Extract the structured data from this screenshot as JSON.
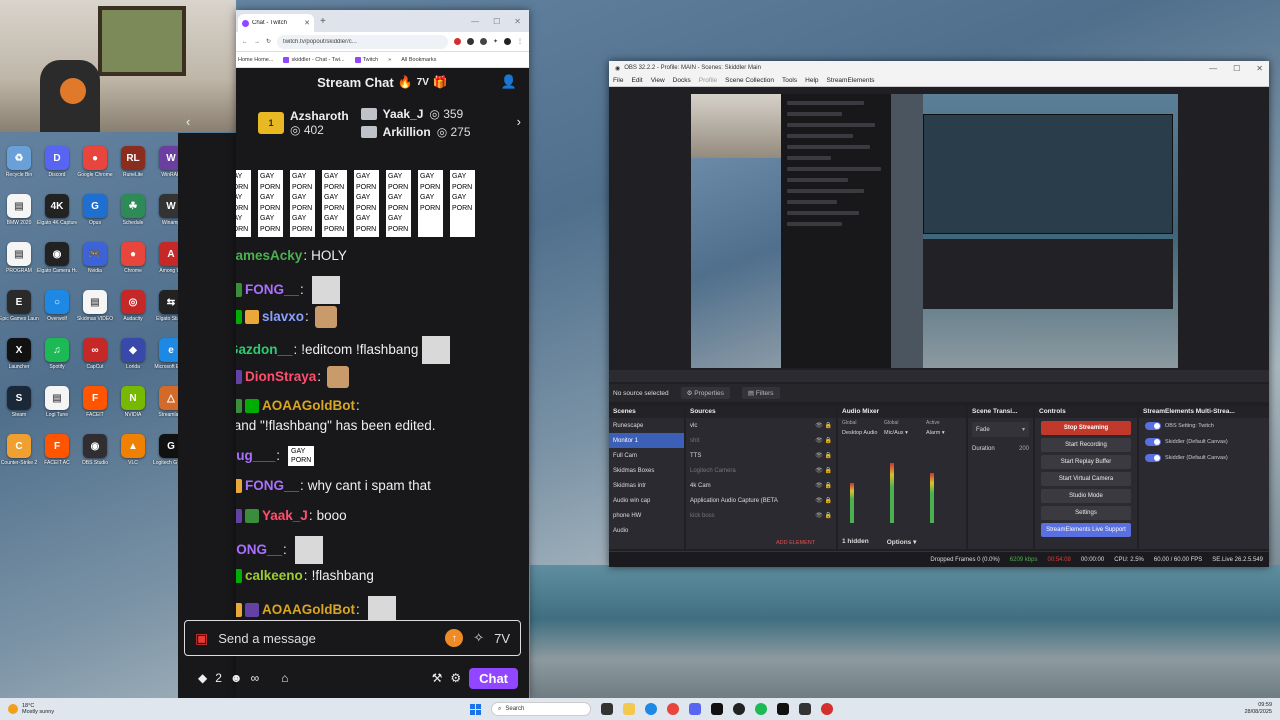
{
  "desktop": {
    "icons": [
      {
        "label": "Recycle Bin",
        "color": "#6aa0d8",
        "glyph": "♻"
      },
      {
        "label": "Discord",
        "color": "#5865f2",
        "glyph": "D"
      },
      {
        "label": "Google Chrome",
        "color": "#e8453c",
        "glyph": "●"
      },
      {
        "label": "RuneLite",
        "color": "#8a2d1e",
        "glyph": "RL"
      },
      {
        "label": "WinRAR",
        "color": "#6b3fa0",
        "glyph": "W"
      },
      {
        "label": "BMW 2020",
        "color": "#f5f5f5",
        "glyph": "▤"
      },
      {
        "label": "Elgato 4K Capture",
        "color": "#222",
        "glyph": "4K"
      },
      {
        "label": "Opus",
        "color": "#1f6fd1",
        "glyph": "G"
      },
      {
        "label": "Schedule",
        "color": "#2e8b57",
        "glyph": "☘"
      },
      {
        "label": "Winamp",
        "color": "#333",
        "glyph": "W"
      },
      {
        "label": "PROGRAM",
        "color": "#f5f5f5",
        "glyph": "▤"
      },
      {
        "label": "Elgato Camera Hub",
        "color": "#222",
        "glyph": "◉"
      },
      {
        "label": "Nvidia",
        "color": "#3c64d8",
        "glyph": "🎮"
      },
      {
        "label": "Chrome",
        "color": "#e8453c",
        "glyph": "●"
      },
      {
        "label": "Among Us",
        "color": "#c62828",
        "glyph": "A"
      },
      {
        "label": "Epic Games Launcher",
        "color": "#2a2a2a",
        "glyph": "E"
      },
      {
        "label": "Overwolf",
        "color": "#1e88e5",
        "glyph": "○"
      },
      {
        "label": "Skidmas VIDEO",
        "color": "#f5f5f5",
        "glyph": "▤"
      },
      {
        "label": "Audacity",
        "color": "#c62828",
        "glyph": "◎"
      },
      {
        "label": "Elgato Studio",
        "color": "#222",
        "glyph": "⇆"
      },
      {
        "label": "Launcher",
        "color": "#111",
        "glyph": "X"
      },
      {
        "label": "Spotify",
        "color": "#1db954",
        "glyph": "♫"
      },
      {
        "label": "CapCut",
        "color": "#c62828",
        "glyph": "∞"
      },
      {
        "label": "Lorida",
        "color": "#3949ab",
        "glyph": "◆"
      },
      {
        "label": "Microsoft Edge",
        "color": "#1e88e5",
        "glyph": "e"
      },
      {
        "label": "Steam",
        "color": "#1b2838",
        "glyph": "S"
      },
      {
        "label": "Logi Tune",
        "color": "#f5f5f5",
        "glyph": "▤"
      },
      {
        "label": "FACEIT",
        "color": "#ff5500",
        "glyph": "F"
      },
      {
        "label": "NVIDIA",
        "color": "#76b900",
        "glyph": "N"
      },
      {
        "label": "Streamlabs",
        "color": "#d36a2a",
        "glyph": "△"
      },
      {
        "label": "Counter-Strike 2",
        "color": "#f0a030",
        "glyph": "C"
      },
      {
        "label": "FACEIT AC",
        "color": "#ff5500",
        "glyph": "F"
      },
      {
        "label": "OBS Studio",
        "color": "#302e31",
        "glyph": "◉"
      },
      {
        "label": "VLC",
        "color": "#f08000",
        "glyph": "▲"
      },
      {
        "label": "Logitech G HUB",
        "color": "#111",
        "glyph": "G"
      }
    ]
  },
  "browser": {
    "tab_title": "Chat - Twitch",
    "url": "twitch.tv/popout/skiddler/c...",
    "bookmarks": [
      "Home Home...",
      "skiddler - Chat - Twi...",
      "Twitch"
    ],
    "all_bookmarks": "All Bookmarks"
  },
  "chat": {
    "header_title": "Stream Chat",
    "leaderboard": {
      "first": {
        "name": "Azsharoth",
        "count": "402",
        "rank": "1"
      },
      "others": [
        {
          "name": "Yaak_J",
          "count": "359"
        },
        {
          "name": "Arkillion",
          "count": "275"
        }
      ]
    },
    "spam_blocks": [
      "GAY PORN GAY PORN GAY PORN",
      "GAY PORN GAY PORN GAY PORN",
      "GAY PORN GAY PORN GAY PORN",
      "GAY PORN GAY PORN GAY PORN",
      "GAY PORN GAY PORN GAY PORN",
      "GAY PORN GAY PORN GAY PORN",
      "GAY PORN GAY PORN GAY PORN",
      "GAY PORN GAY PORN",
      "GAY PORN GAY PORN"
    ],
    "messages": [
      {
        "user": "JamesAcky",
        "color": "#4caf50",
        "text": "HOLY"
      },
      {
        "user": "FONG__",
        "color": "#a970ff",
        "text": ""
      },
      {
        "user": "slavxo",
        "color": "#8aa0ff",
        "text": ""
      },
      {
        "user": "Gazdon__",
        "color": "#2ecc71",
        "text": "!editcom !flashbang"
      },
      {
        "user": "DionStraya",
        "color": "#ff4f6d",
        "text": ""
      },
      {
        "user": "AOAAGoldBot",
        "color": "#daa520",
        "text": "Command \"!flashbang\" has been edited."
      },
      {
        "user": "Fug___",
        "color": "#a970ff",
        "text": ""
      },
      {
        "user": "FONG__",
        "color": "#a970ff",
        "text": "why cant i spam that"
      },
      {
        "user": "Yaak_J",
        "color": "#ff4f6d",
        "text": "booo"
      },
      {
        "user": "FONG__",
        "color": "#a970ff",
        "text": ""
      },
      {
        "user": "calkeeno",
        "color": "#9acd32",
        "text": "!flashbang"
      },
      {
        "user": "AOAAGoldBot",
        "color": "#daa520",
        "text": ""
      }
    ],
    "inline_gay_porn": "GAY PORN",
    "input_placeholder": "Send a message",
    "points": "2",
    "infinity": "∞",
    "chat_button": "Chat"
  },
  "obs": {
    "title": "OBS 32.2.2 - Profile: MAIN - Scenes: Skiddler Main",
    "menu": [
      "File",
      "Edit",
      "View",
      "Docks",
      "Profile",
      "Scene Collection",
      "Tools",
      "Help",
      "StreamElements"
    ],
    "no_source": "No source selected",
    "properties": "Properties",
    "filters": "Filters",
    "docks": {
      "scenes_title": "Scenes",
      "scenes": [
        "Runescape",
        "Monitor 1",
        "Full Cam",
        "Skidmas Boxes",
        "Skidmas intr",
        "Audio win cap",
        "phone HW",
        "Audio"
      ],
      "selected_scene": 1,
      "sources_title": "Sources",
      "sources": [
        "vlc",
        "shit",
        "TTS",
        "Logitech Camera",
        "4k Cam",
        "Application Audio Capture (BETA",
        "kick boss"
      ],
      "add_element": "ADD ELEMENT",
      "mixer_title": "Audio Mixer",
      "mixer_channels": [
        "Desktop Audio",
        "Mic/Aux",
        "Alarm"
      ],
      "mixer_labels": [
        "Global",
        "Global",
        "Active"
      ],
      "hidden": "1 hidden",
      "options": "Options",
      "transitions_title": "Scene Transi...",
      "transition": "Fade",
      "duration_label": "Duration",
      "duration": "200",
      "controls_title": "Controls",
      "controls": [
        "Stop Streaming",
        "Start Recording",
        "Start Replay Buffer",
        "Start Virtual Camera",
        "Studio Mode",
        "Settings",
        "StreamElements Live Support"
      ],
      "se_title": "StreamElements Multi-Strea...",
      "se_rows": [
        "OBS Setting: Twitch",
        "Skiddler (Default Canvas)",
        "Skiddler (Default Canvas)"
      ]
    },
    "status": {
      "dropped": "Dropped Frames 0 (0.0%)",
      "bitrate": "6209 kbps",
      "live_time": "00:54:08",
      "rec_time": "00:00:00",
      "cpu": "CPU: 2.5%",
      "fps": "60.00 / 60.00 FPS",
      "version": "SE.Live 26.2.5.549"
    }
  },
  "taskbar": {
    "weather_temp": "18°C",
    "weather_desc": "Mostly sunny",
    "search": "Search",
    "time": "09:59",
    "date": "28/08/2025"
  }
}
